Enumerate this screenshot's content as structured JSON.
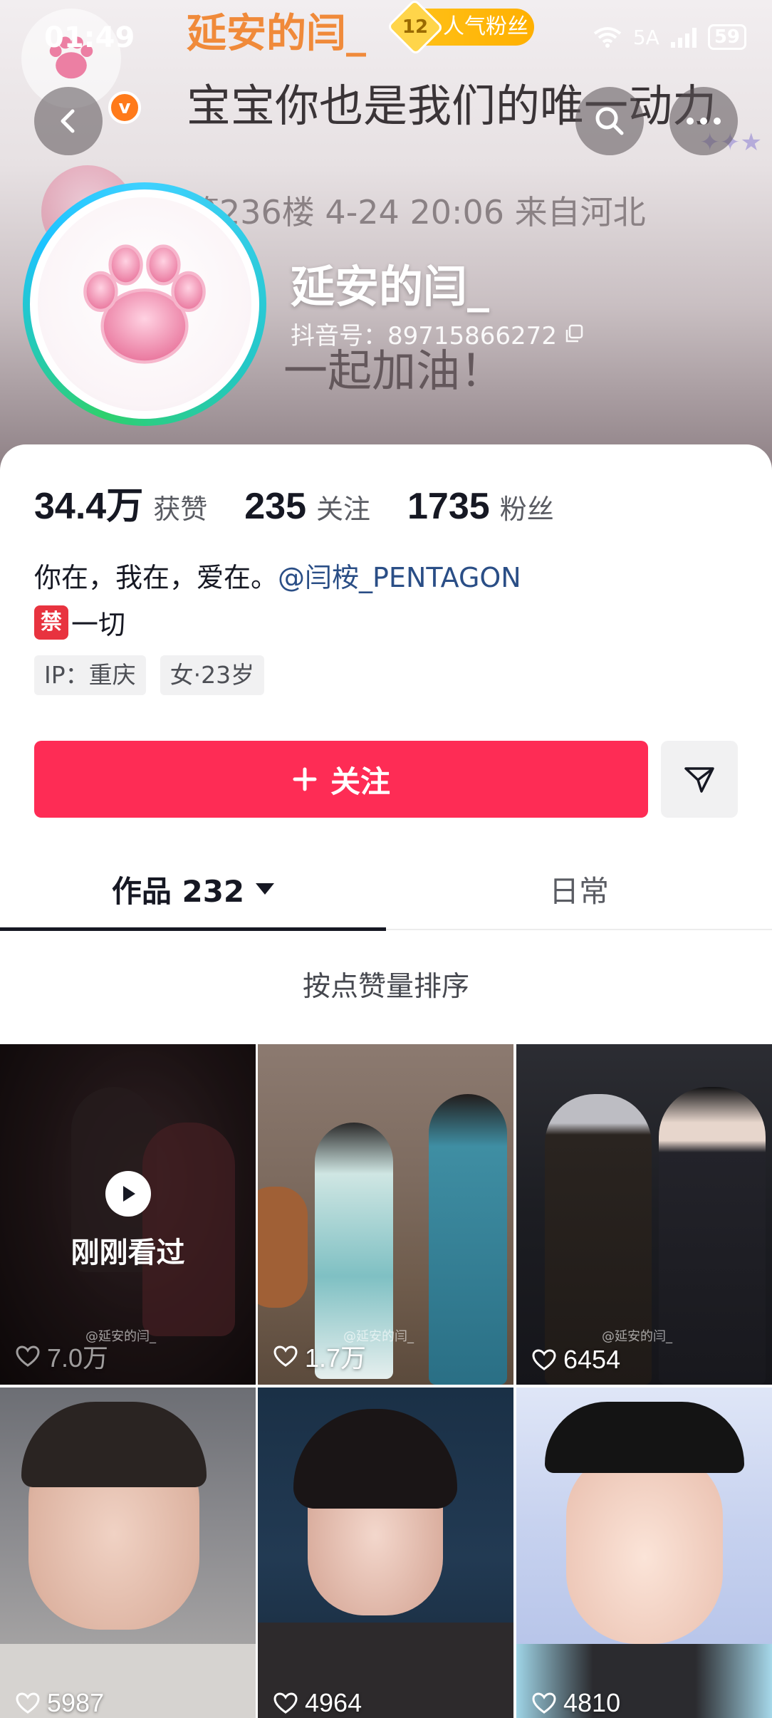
{
  "status_bar": {
    "time": "01:49",
    "network": "5A",
    "battery": "59"
  },
  "background_comments": {
    "username": "延安的闫_",
    "fan_level": "12",
    "fan_badge": "人气粉丝",
    "comment_1": "宝宝你也是我们的唯一动力",
    "floor_info": "第236楼 4-24 20:06 来自河北",
    "comment_2": "一起加油！"
  },
  "profile": {
    "name": "延安的闫_",
    "douyin_id": "抖音号：89715866272"
  },
  "stats": {
    "likes_value": "34.4万",
    "likes_label": "获赞",
    "following_value": "235",
    "following_label": "关注",
    "followers_value": "1735",
    "followers_label": "粉丝"
  },
  "bio": {
    "line1_text": "你在，我在，爱在。",
    "line1_mention": "@闫桉_PENTAGON",
    "ban_icon_text": "禁",
    "line2_text": "一切"
  },
  "tags": [
    "IP：重庆",
    "女·23岁"
  ],
  "actions": {
    "follow_label": "关注"
  },
  "tabs": {
    "works_label": "作品 232",
    "daily_label": "日常"
  },
  "sort_label": "按点赞量排序",
  "videos": [
    {
      "likes": "7.0万",
      "overlay": "刚刚看过",
      "watermark": "@延安的闫_"
    },
    {
      "likes": "1.7万",
      "watermark": "@延安的闫_"
    },
    {
      "likes": "6454",
      "watermark": "@延安的闫_"
    },
    {
      "likes": "5987"
    },
    {
      "likes": "4964"
    },
    {
      "likes": "4810"
    }
  ],
  "colors": {
    "accent": "#fe2c55",
    "mention": "#2a4e86",
    "avatar_ring": "#3fd1ff"
  }
}
